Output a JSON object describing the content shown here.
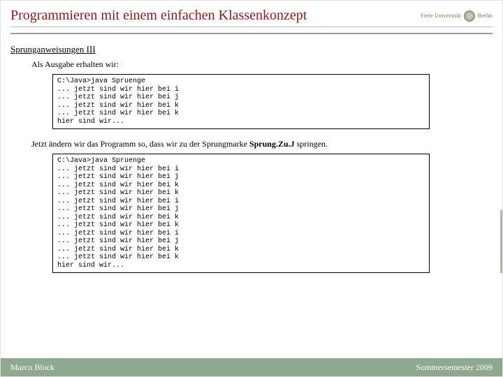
{
  "header": {
    "title": "Programmieren mit einem einfachen Klassenkonzept",
    "logo_text": "Freie Universität",
    "logo_city": "Berlin"
  },
  "section": {
    "subheading": "Sprunganweisungen III",
    "intro": "Als Ausgabe erhalten wir:",
    "code1": "C:\\Java>java Spruenge\n... jetzt sind wir hier bei i\n... jetzt sind wir hier bei j\n... jetzt sind wir hier bei k\n... jetzt sind wir hier bei k\nhier sind wir...",
    "between_pre": "Jetzt ändern wir das Programm so, dass wir zu der Sprungmarke ",
    "between_bold": "Sprung.Zu.J",
    "between_post": " springen.",
    "code2": "C:\\Java>java Spruenge\n... jetzt sind wir hier bei i\n... jetzt sind wir hier bei j\n... jetzt sind wir hier bei k\n... jetzt sind wir hier bei k\n... jetzt sind wir hier bei i\n... jetzt sind wir hier bei j\n... jetzt sind wir hier bei k\n... jetzt sind wir hier bei k\n... jetzt sind wir hier bei i\n... jetzt sind wir hier bei j\n... jetzt sind wir hier bei k\n... jetzt sind wir hier bei k\nhier sind wir..."
  },
  "footer": {
    "author": "Marco Block",
    "term": "Sommersemester 2009"
  }
}
